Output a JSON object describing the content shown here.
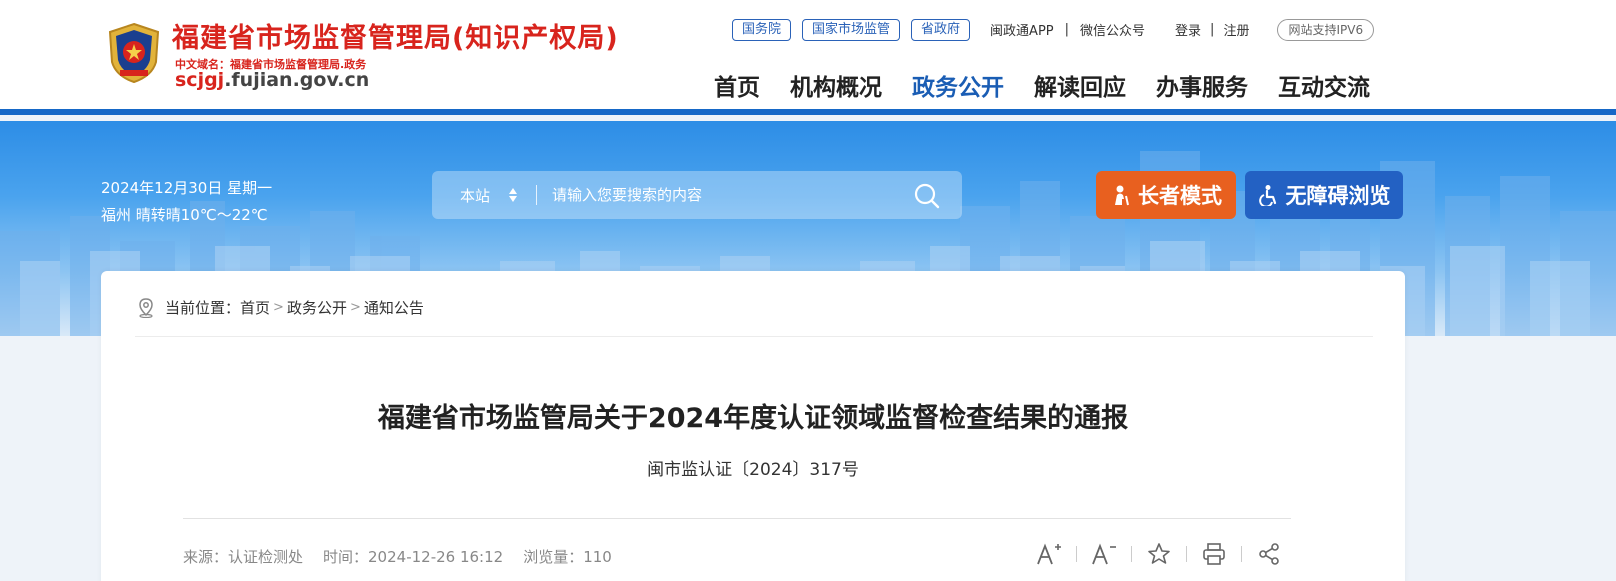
{
  "header": {
    "title": "福建省市场监督管理局(知识产权局)",
    "cn_domain": "中文域名：福建省市场监督管理局.政务",
    "domain_prefix": "scjgj",
    "domain_suffix": ".fujian.gov.cn",
    "links": {
      "state_council": "国务院",
      "samr": "国家市场监管",
      "provincial_gov": "省政府",
      "app": "闽政通APP",
      "wechat": "微信公众号",
      "login": "登录",
      "register": "注册",
      "ipv6": "网站支持IPV6"
    },
    "nav": [
      {
        "label": "首页"
      },
      {
        "label": "机构概况"
      },
      {
        "label": "政务公开",
        "active": true
      },
      {
        "label": "解读回应"
      },
      {
        "label": "办事服务"
      },
      {
        "label": "互动交流"
      }
    ]
  },
  "banner": {
    "date": "2024年12月30日 星期一",
    "weather": "福州 晴转晴10℃～22℃",
    "search": {
      "scope": "本站",
      "placeholder": "请输入您要搜索的内容"
    },
    "elder_mode": "长者模式",
    "accessible": "无障碍浏览"
  },
  "breadcrumb": {
    "prefix": "当前位置：",
    "items": [
      "首页",
      "政务公开",
      "通知公告"
    ]
  },
  "article": {
    "title": "福建省市场监管局关于2024年度认证领域监督检查结果的通报",
    "doc_number": "闽市监认证〔2024〕317号",
    "source": "来源：认证检测处",
    "time": "时间：2024-12-26 16:12",
    "views": "浏览量：110"
  },
  "colors": {
    "brand_red": "#d8241d",
    "nav_active": "#1a5db4",
    "elder_button": "#e8601f",
    "accessible_button": "#2361c3"
  }
}
